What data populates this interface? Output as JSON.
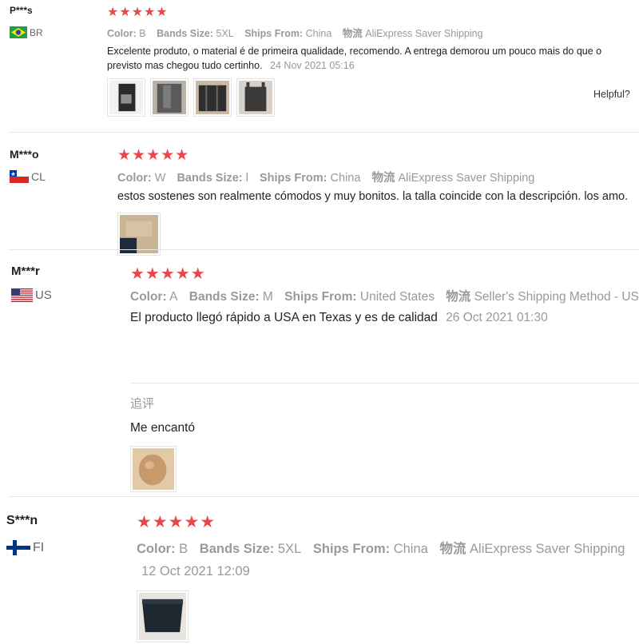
{
  "reviews": [
    {
      "user": "P***s",
      "country": "BR",
      "flag_icon": "brazil-flag-icon",
      "rating": 5,
      "stars": "★★★★★",
      "color_label": "Color:",
      "color_value": "B",
      "size_label": "Bands Size:",
      "size_value": "5XL",
      "ships_label": "Ships From:",
      "ships_value": "China",
      "shipping_label": "物流",
      "shipping_value": "AliExpress Saver Shipping",
      "text": "Excelente produto, o material é de primeira qualidade, recomendo. A entrega demorou um pouco mais do que o previsto mas chegou tudo certinho.",
      "date": "24 Nov 2021 05:16",
      "helpful": "Helpful?",
      "photos": 4
    },
    {
      "user": "M***o",
      "country": "CL",
      "flag_icon": "chile-flag-icon",
      "rating": 5,
      "stars": "★★★★★",
      "color_label": "Color:",
      "color_value": "W",
      "size_label": "Bands Size:",
      "size_value": "l",
      "ships_label": "Ships From:",
      "ships_value": "China",
      "shipping_label": "物流",
      "shipping_value": "AliExpress Saver Shipping",
      "text": "estos sostenes son realmente cómodos y muy bonitos. la talla coincide con la descripción. los amo.",
      "photos": 1
    },
    {
      "user": "M***r",
      "country": "US",
      "flag_icon": "usa-flag-icon",
      "rating": 5,
      "stars": "★★★★★",
      "color_label": "Color:",
      "color_value": "A",
      "size_label": "Bands Size:",
      "size_value": "M",
      "ships_label": "Ships From:",
      "ships_value": "United States",
      "shipping_label": "物流",
      "shipping_value": "Seller's Shipping Method - US",
      "text": "El producto llegó rápido a USA en Texas y es de calidad",
      "date": "26 Oct 2021 01:30",
      "followup_label": "追评",
      "followup_text": "Me encantó",
      "photos": 1
    },
    {
      "user": "S***n",
      "country": "FI",
      "flag_icon": "finland-flag-icon",
      "rating": 5,
      "stars": "★★★★★",
      "color_label": "Color:",
      "color_value": "B",
      "size_label": "Bands Size:",
      "size_value": "5XL",
      "ships_label": "Ships From:",
      "ships_value": "China",
      "shipping_label": "物流",
      "shipping_value": "AliExpress Saver Shipping",
      "date": "12 Oct 2021 12:09",
      "photos": 1
    }
  ],
  "colors": {
    "star": "#e8484a",
    "meta": "#999999",
    "text": "#222222",
    "divider": "#e6e6e6"
  }
}
